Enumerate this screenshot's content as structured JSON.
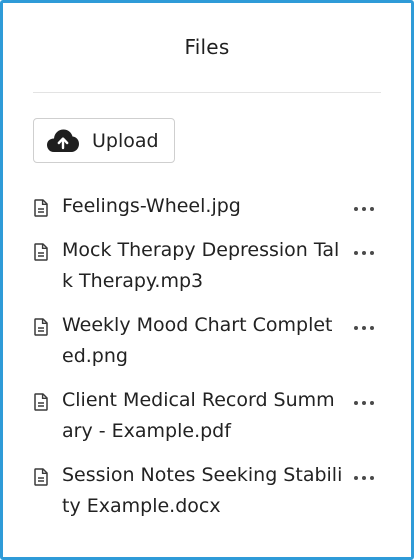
{
  "panel": {
    "title": "Files",
    "upload_label": "Upload",
    "upload_icon": "cloud-upload-icon",
    "accent_border": "#2f9bd8"
  },
  "files": [
    {
      "name": "Feelings-Wheel.jpg",
      "icon": "file-document-icon"
    },
    {
      "name": "Mock Therapy Depression Talk Therapy.mp3",
      "icon": "file-document-icon"
    },
    {
      "name": "Weekly Mood Chart Completed.png",
      "icon": "file-document-icon"
    },
    {
      "name": "Client Medical Record Summary - Example.pdf",
      "icon": "file-document-icon"
    },
    {
      "name": "Session Notes Seeking Stability Example.docx",
      "icon": "file-document-icon"
    }
  ],
  "row_actions_icon": "more-horizontal-icon"
}
